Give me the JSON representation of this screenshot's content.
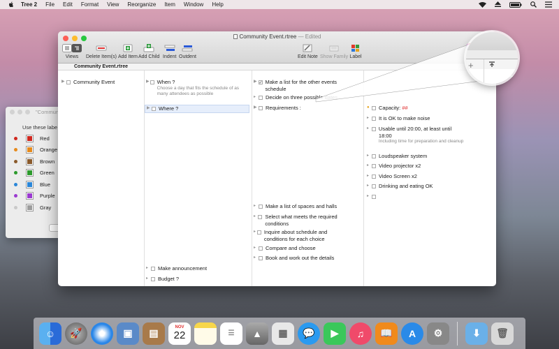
{
  "menubar": {
    "app_name": "Tree 2",
    "items": [
      "File",
      "Edit",
      "Format",
      "View",
      "Reorganize",
      "Item",
      "Window",
      "Help"
    ]
  },
  "labels_panel": {
    "title": "\"Communi",
    "hint": "Use these labe",
    "labels": [
      {
        "name": "Red",
        "color": "#d0281f"
      },
      {
        "name": "Orange",
        "color": "#e68a1c"
      },
      {
        "name": "Brown",
        "color": "#8a5a2b"
      },
      {
        "name": "Green",
        "color": "#2c9a2c"
      },
      {
        "name": "Blue",
        "color": "#2a86d8"
      },
      {
        "name": "Purple",
        "color": "#9b3ad0"
      },
      {
        "name": "Gray",
        "color": "#9c9c9c"
      }
    ]
  },
  "window": {
    "title": "Community Event.rtree",
    "edited": "— Edited",
    "toolbar": {
      "views": "Views",
      "delete": "Delete Item(s)",
      "add_item": "Add Item",
      "add_child": "Add Child",
      "indent": "Indent",
      "outdent": "Outdent",
      "edit_note": "Edit Note",
      "show_family": "Show Family",
      "label": "Label",
      "fonts_partial": "onts"
    },
    "column_header": "Community Event.rtree"
  },
  "tree": {
    "root": "Community Event",
    "when": {
      "title": "When ?",
      "note": "Choose a day that fits the schedule of as many attendees as possible"
    },
    "where": {
      "title": "Where ?"
    },
    "make_announcement": "Make announcement",
    "budget": "Budget ?",
    "when_children": [
      "Make a list for the other events schedule",
      "Decide on three possible dates"
    ],
    "where_children": [
      "Requirements :",
      "Make a list of spaces and halls",
      "Select what meets the required conditions",
      "Inquire about schedule and conditions for each choice",
      "Compare and choose",
      "Book and work out the details"
    ],
    "requirements": {
      "capacity_label": "Capacity:",
      "capacity_value": "##",
      "items": [
        "It is OK to make noise",
        "Usable until 20:00, at least until 18:00",
        "Loudspeaker system",
        "Video projector x2",
        "Video Screen x2",
        "Drinking and eating OK"
      ],
      "usable_note": "Including time for preparation and cleanup"
    }
  },
  "dock": {
    "calendar_month": "NOV",
    "calendar_day": "22"
  }
}
